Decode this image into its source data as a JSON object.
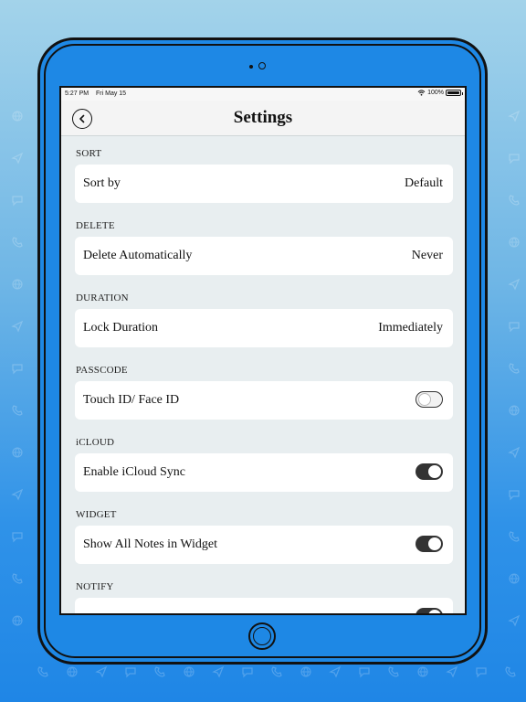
{
  "status_bar": {
    "time": "5:27 PM",
    "date": "Fri May 15",
    "battery": "100%",
    "wifi_icon": "wifi-icon",
    "battery_icon": "battery-icon"
  },
  "nav": {
    "title": "Settings",
    "back_icon": "chevron-left-circle-icon"
  },
  "sections": [
    {
      "header": "SORT",
      "row_label": "Sort by",
      "row_value": "Default"
    },
    {
      "header": "DELETE",
      "row_label": "Delete Automatically",
      "row_value": "Never"
    },
    {
      "header": "DURATION",
      "row_label": "Lock Duration",
      "row_value": "Immediately"
    },
    {
      "header": "PASSCODE",
      "row_label": "Touch ID/ Face ID",
      "toggle": false
    },
    {
      "header": "iCLOUD",
      "row_label": "Enable iCloud Sync",
      "toggle": true
    },
    {
      "header": "WIDGET",
      "row_label": "Show All Notes in Widget",
      "toggle": true
    },
    {
      "header": "NOTIFY",
      "toggle": true
    }
  ],
  "colors": {
    "background_top": "#a3d3ea",
    "background_bottom": "#1f86e6",
    "toggle_on": "#333333",
    "list_background": "#e8eef0"
  }
}
